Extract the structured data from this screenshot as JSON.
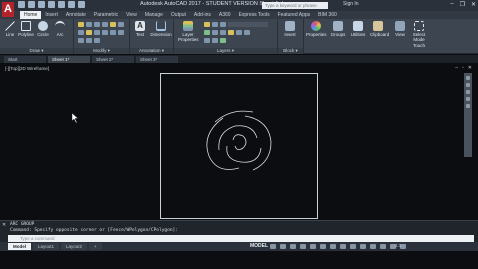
{
  "app": {
    "logo_letter": "A",
    "window_title": "Autodesk AutoCAD 2017 - STUDENT VERSION   Sheet 1.dwg",
    "search_placeholder": "Type a keyword or phrase",
    "signin_label": "Sign In",
    "window_controls": [
      "–",
      "❐",
      "✕"
    ]
  },
  "ribbon": {
    "tabs": [
      "Home",
      "Insert",
      "Annotate",
      "Parametric",
      "View",
      "Manage",
      "Output",
      "Add-ins",
      "A360",
      "Express Tools",
      "Featured Apps",
      "BIM 360"
    ],
    "active_tab": "Home",
    "panels": {
      "draw": {
        "title": "Draw ▾",
        "tools": [
          "Line",
          "Polyline",
          "Circle",
          "Arc"
        ]
      },
      "modify": {
        "title": "Modify ▾"
      },
      "annotation": {
        "title": "Annotation ▾",
        "tools": [
          "Text",
          "Dimension"
        ]
      },
      "layers": {
        "title": "Layers ▾",
        "tools": [
          "Layer Properties"
        ]
      },
      "block": {
        "title": "Block ▾",
        "tools": [
          "Insert"
        ]
      },
      "right_tools": [
        "Properties",
        "Groups",
        "Utilities",
        "Clipboard",
        "View",
        "Select Mode",
        "Touch"
      ]
    }
  },
  "file_tabs": [
    "Start",
    "Sheet 1*",
    "Sheet 2*",
    "Sheet 3*"
  ],
  "active_file_tab": "Sheet 1*",
  "viewport": {
    "label": "[-][Top][2D Wireframe]",
    "controls": [
      "–",
      "▫",
      "✕"
    ]
  },
  "command": {
    "close_glyph": "✕",
    "history": [
      "ARC GROUP",
      "Command: Specify opposite corner or [Fence/WPolygon/CPolygon]:"
    ],
    "input_placeholder": "Type a command"
  },
  "status": {
    "layout_tabs": [
      "Model",
      "Layout1",
      "Layout2",
      "+"
    ],
    "active_layout": "Model",
    "space_label": "MODEL",
    "scale": "1:1"
  },
  "colors": {
    "accent_red": "#b5232a",
    "drawing_bg": "#0b0d10",
    "paper_border": "#c9d0d7"
  }
}
